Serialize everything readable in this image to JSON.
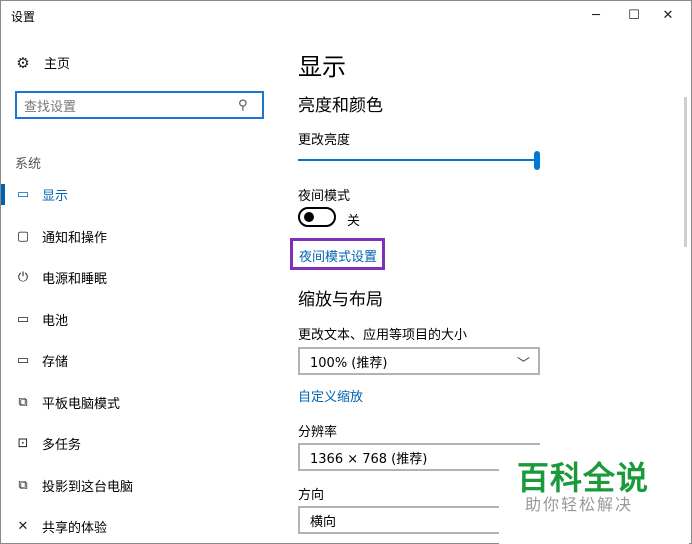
{
  "window": {
    "title": "设置",
    "minimize_glyph": "─",
    "maximize_glyph": "☐",
    "close_glyph": "✕"
  },
  "sidebar": {
    "home_label": "主页",
    "search_placeholder": "查找设置",
    "section_label": "系统",
    "items": [
      {
        "label": "显示",
        "icon": "monitor-icon",
        "glyph": "▭",
        "active": true
      },
      {
        "label": "通知和操作",
        "icon": "message-icon",
        "glyph": "▢",
        "active": false
      },
      {
        "label": "电源和睡眠",
        "icon": "power-icon",
        "glyph": "⏻",
        "active": false
      },
      {
        "label": "电池",
        "icon": "battery-icon",
        "glyph": "▭",
        "active": false
      },
      {
        "label": "存储",
        "icon": "storage-icon",
        "glyph": "▭",
        "active": false
      },
      {
        "label": "平板电脑模式",
        "icon": "tablet-mode-icon",
        "glyph": "⧉",
        "active": false
      },
      {
        "label": "多任务",
        "icon": "multitask-icon",
        "glyph": "⊡",
        "active": false
      },
      {
        "label": "投影到这台电脑",
        "icon": "project-icon",
        "glyph": "⧉",
        "active": false
      },
      {
        "label": "共享的体验",
        "icon": "shared-experiences-icon",
        "glyph": "✕",
        "active": false
      }
    ]
  },
  "main": {
    "page_title": "显示",
    "brightness_section": "亮度和颜色",
    "brightness_label": "更改亮度",
    "brightness_value": 1.0,
    "night_mode_label": "夜间模式",
    "night_mode_state": "关",
    "night_mode_link": "夜间模式设置",
    "scale_section": "缩放与布局",
    "scale_label": "更改文本、应用等项目的大小",
    "scale_value": "100% (推荐)",
    "custom_scale_link": "自定义缩放",
    "resolution_label": "分辨率",
    "resolution_value": "1366 × 768 (推荐)",
    "orientation_label": "方向",
    "orientation_value": "横向"
  },
  "watermark": {
    "brand": "百科全说",
    "subtitle": "助你轻松解决"
  },
  "colors": {
    "accent": "#0063b1",
    "highlight_box": "#7f30b6",
    "watermark_green": "#1a9a3a"
  }
}
